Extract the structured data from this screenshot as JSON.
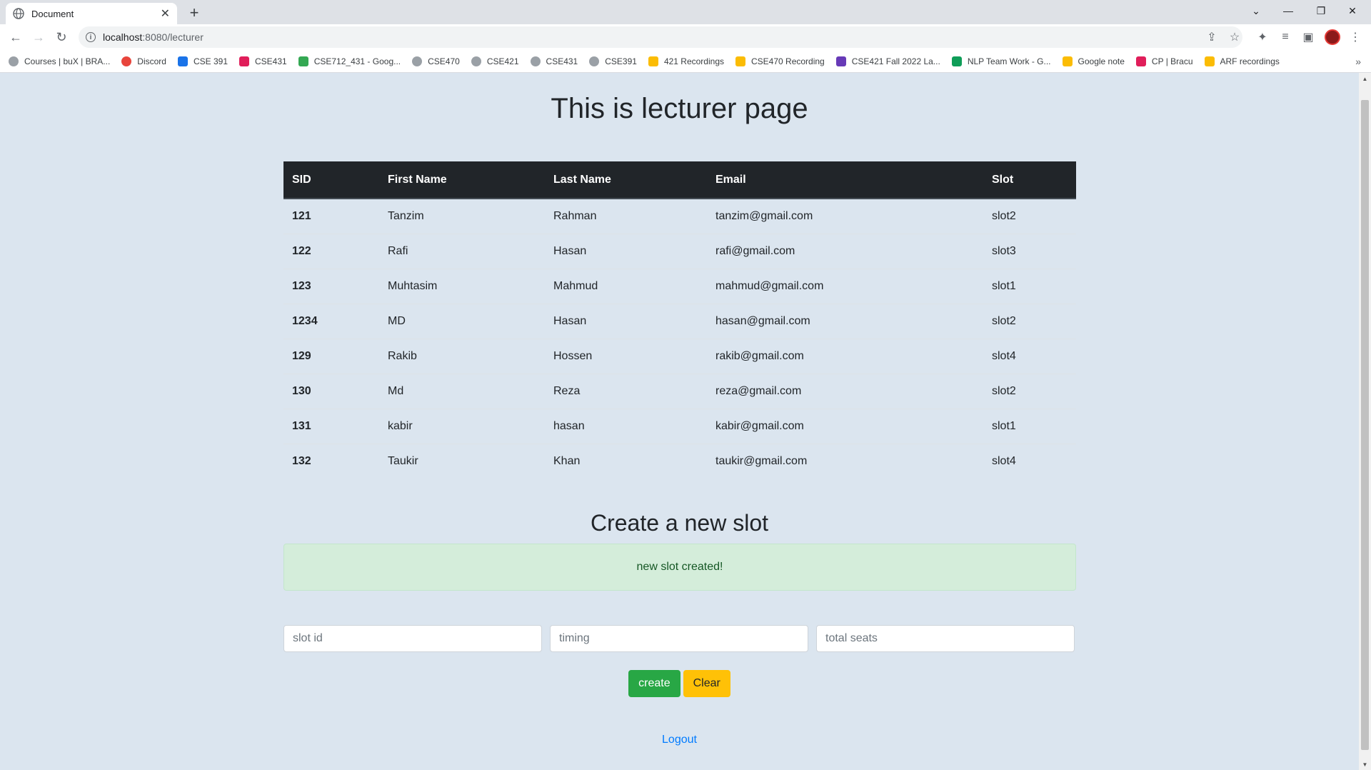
{
  "browser": {
    "tab_title": "Document",
    "url_host": "localhost",
    "url_path": ":8080/lecturer",
    "bookmarks": [
      {
        "label": "Courses | buX | BRA...",
        "color": "#9aa0a6"
      },
      {
        "label": "Discord",
        "color": "#e8453c"
      },
      {
        "label": "CSE 391",
        "color": "#1a73e8"
      },
      {
        "label": "CSE431",
        "color": "#e01e5a"
      },
      {
        "label": "CSE712_431 - Goog...",
        "color": "#34a853"
      },
      {
        "label": "CSE470",
        "color": "#9aa0a6"
      },
      {
        "label": "CSE421",
        "color": "#9aa0a6"
      },
      {
        "label": "CSE431",
        "color": "#9aa0a6"
      },
      {
        "label": "CSE391",
        "color": "#9aa0a6"
      },
      {
        "label": "421 Recordings",
        "color": "#fbbc04"
      },
      {
        "label": "CSE470 Recording",
        "color": "#fbbc04"
      },
      {
        "label": "CSE421 Fall 2022 La...",
        "color": "#673ab7"
      },
      {
        "label": "NLP Team Work - G...",
        "color": "#0f9d58"
      },
      {
        "label": "Google note",
        "color": "#fbbc04"
      },
      {
        "label": "CP | Bracu",
        "color": "#e01e5a"
      },
      {
        "label": "ARF recordings",
        "color": "#fbbc04"
      }
    ]
  },
  "page": {
    "title": "This is lecturer page",
    "table": {
      "headers": [
        "SID",
        "First Name",
        "Last Name",
        "Email",
        "Slot"
      ],
      "rows": [
        [
          "121",
          "Tanzim",
          "Rahman",
          "tanzim@gmail.com",
          "slot2"
        ],
        [
          "122",
          "Rafi",
          "Hasan",
          "rafi@gmail.com",
          "slot3"
        ],
        [
          "123",
          "Muhtasim",
          "Mahmud",
          "mahmud@gmail.com",
          "slot1"
        ],
        [
          "1234",
          "MD",
          "Hasan",
          "hasan@gmail.com",
          "slot2"
        ],
        [
          "129",
          "Rakib",
          "Hossen",
          "rakib@gmail.com",
          "slot4"
        ],
        [
          "130",
          "Md",
          "Reza",
          "reza@gmail.com",
          "slot2"
        ],
        [
          "131",
          "kabir",
          "hasan",
          "kabir@gmail.com",
          "slot1"
        ],
        [
          "132",
          "Taukir",
          "Khan",
          "taukir@gmail.com",
          "slot4"
        ]
      ]
    },
    "create_section": {
      "title": "Create a new slot",
      "alert": "new slot created!",
      "inputs": {
        "slot_id_placeholder": "slot id",
        "timing_placeholder": "timing",
        "total_seats_placeholder": "total seats"
      },
      "create_label": "create",
      "clear_label": "Clear"
    },
    "logout_label": "Logout"
  }
}
